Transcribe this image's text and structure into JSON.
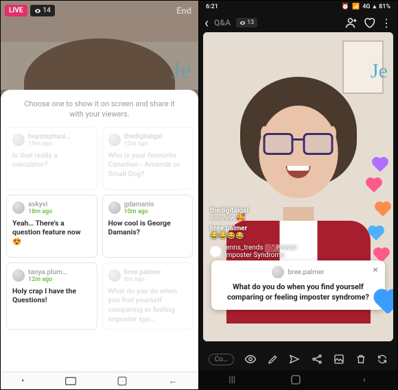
{
  "left": {
    "live_label": "LIVE",
    "viewer_count": "14",
    "end_label": "End",
    "sheet_title": "Choose one to show it on screen and share it with your viewers.",
    "cards": [
      {
        "user": "heystephani…",
        "time": "19m ago",
        "text": "Is that really a calculator?",
        "dim": true
      },
      {
        "user": "thedigitalgal",
        "time": "12m ago",
        "text": "Who is your favourite Canadian - Amanda or Small Dog?",
        "dim": true
      },
      {
        "user": "askyvi",
        "time": "18m ago",
        "text": "Yeah… There's a question feature now 😍",
        "dim": false
      },
      {
        "user": "gdamanis",
        "time": "10m ago",
        "text": "How cool is George Damanis?",
        "dim": false
      },
      {
        "user": "tanya.plum…",
        "time": "12m ago",
        "text": "Holy crap I have the Questions!",
        "dim": false
      },
      {
        "user": "bree.palmer",
        "time": "8m ago",
        "text": "What do you do when you find yourself comparing or feeling imposter syn…",
        "dim": true
      }
    ]
  },
  "right": {
    "status_time": "6:21",
    "status_net": "4G",
    "status_batt": "81%",
    "qa_label": "Q&A",
    "viewer_count": "13",
    "comments": [
      {
        "user": "thedigitalgal",
        "text": "Awwww 🥰"
      },
      {
        "user": "bree.palmer",
        "text": "😂😂😂😂"
      }
    ],
    "pinned": {
      "user": "jenns_trends",
      "badge": "📌 PINNED",
      "text": "Imposter Syndrome"
    },
    "question_card": {
      "user": "bree.palmer",
      "text": "What do you do when you find yourself comparing or feeling imposter syndrome?"
    }
  }
}
